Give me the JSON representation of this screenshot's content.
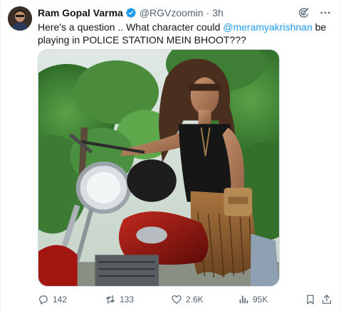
{
  "author": {
    "name": "Ram Gopal Varma",
    "handle": "@RGVzoomin",
    "separator": "·",
    "time": "3h"
  },
  "post": {
    "text_before": "Here's a question .. What character could ",
    "mention": "@meramyakrishnan",
    "text_after": " be playing in POLICE STATION MEIN BHOOT???"
  },
  "actions": {
    "replies": "142",
    "reposts": "133",
    "likes": "2.6K",
    "views": "95K"
  },
  "colors": {
    "accent": "#1d9bf0",
    "muted": "#536471",
    "text": "#0f1419"
  },
  "icons": {
    "verified": "verified-badge-icon",
    "grok": "grok-icon",
    "more": "more-icon",
    "reply": "reply-icon",
    "repost": "repost-icon",
    "like": "heart-icon",
    "views": "views-icon",
    "bookmark": "bookmark-icon",
    "share": "share-icon"
  }
}
